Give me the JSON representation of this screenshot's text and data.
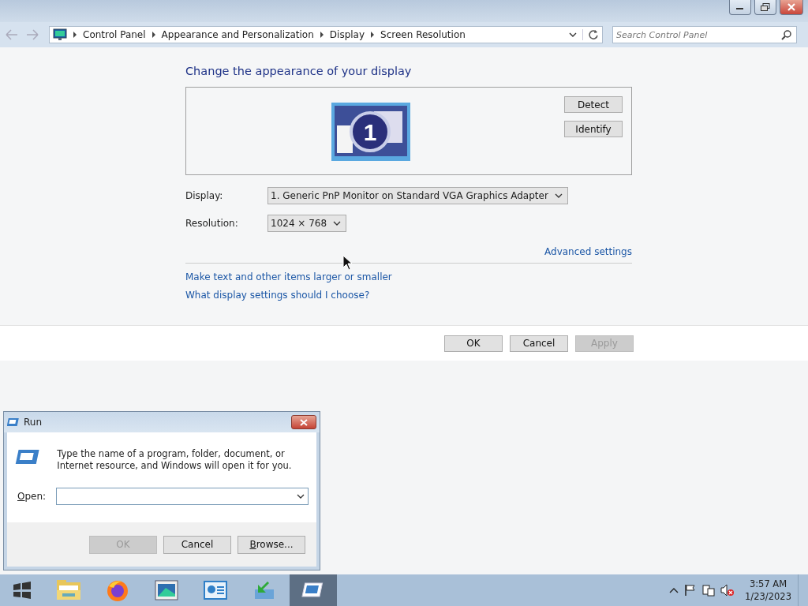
{
  "address_bar": {
    "breadcrumbs": [
      "Control Panel",
      "Appearance and Personalization",
      "Display",
      "Screen Resolution"
    ],
    "search_placeholder": "Search Control Panel"
  },
  "heading": "Change the appearance of your display",
  "monitor": {
    "number": "1",
    "selected": true
  },
  "detect_button": "Detect",
  "identify_button": "Identify",
  "fields": [
    {
      "label": "Display:",
      "value": "1. Generic PnP Monitor on Standard VGA Graphics Adapter"
    },
    {
      "label": "Resolution:",
      "value": "1024 × 768"
    }
  ],
  "advanced_link": "Advanced settings",
  "links": [
    "Make text and other items larger or smaller",
    "What display settings should I choose?"
  ],
  "buttons": [
    {
      "label": "OK",
      "disabled": false
    },
    {
      "label": "Cancel",
      "disabled": false
    },
    {
      "label": "Apply",
      "disabled": true
    }
  ],
  "run_dialog": {
    "title": "Run",
    "description": "Type the name of a program, folder, document, or Internet resource, and Windows will open it for you.",
    "open_label": "Open:",
    "buttons": [
      {
        "label": "OK",
        "disabled": true,
        "mnemonic": false
      },
      {
        "label": "Cancel",
        "disabled": false,
        "mnemonic": false
      },
      {
        "label": "Browse...",
        "disabled": false,
        "mnemonic": true
      }
    ]
  },
  "taskbar": {
    "apps": [
      {
        "kind": "folder",
        "selected": false
      },
      {
        "kind": "firefox",
        "selected": false
      },
      {
        "kind": "display",
        "selected": false
      },
      {
        "kind": "panel",
        "selected": false
      },
      {
        "kind": "install",
        "selected": false
      },
      {
        "kind": "run",
        "selected": true
      }
    ],
    "time": "3:57 AM",
    "date": "1/23/2023"
  }
}
